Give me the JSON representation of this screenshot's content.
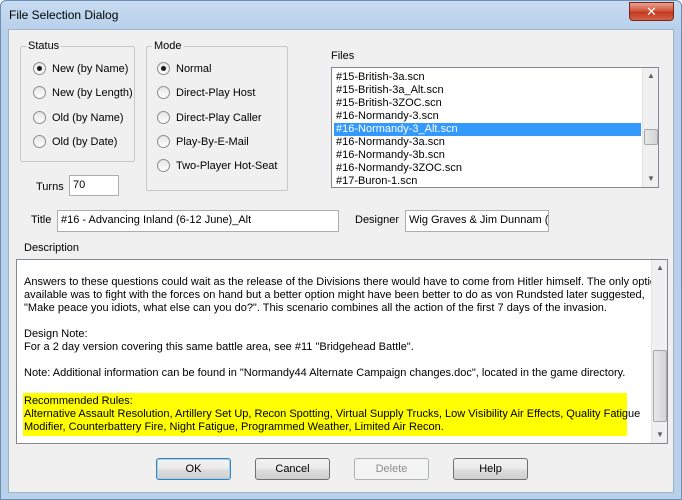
{
  "window": {
    "title": "File Selection Dialog",
    "close_glyph": "✕"
  },
  "status": {
    "label": "Status",
    "options": [
      {
        "label": "New (by Name)",
        "checked": true
      },
      {
        "label": "New (by Length)",
        "checked": false
      },
      {
        "label": "Old (by Name)",
        "checked": false
      },
      {
        "label": "Old (by Date)",
        "checked": false
      }
    ]
  },
  "mode": {
    "label": "Mode",
    "options": [
      {
        "label": "Normal",
        "checked": true
      },
      {
        "label": "Direct-Play Host",
        "checked": false
      },
      {
        "label": "Direct-Play Caller",
        "checked": false
      },
      {
        "label": "Play-By-E-Mail",
        "checked": false
      },
      {
        "label": "Two-Player Hot-Seat",
        "checked": false
      }
    ]
  },
  "turns": {
    "label": "Turns",
    "value": "70"
  },
  "files": {
    "label": "Files",
    "items": [
      "#15-British-3a.scn",
      "#15-British-3a_Alt.scn",
      "#15-British-3ZOC.scn",
      "#16-Normandy-3.scn",
      "#16-Normandy-3_Alt.scn",
      "#16-Normandy-3a.scn",
      "#16-Normandy-3b.scn",
      "#16-Normandy-3ZOC.scn",
      "#17-Buron-1.scn"
    ],
    "selected_index": 4
  },
  "scenario": {
    "title_label": "Title",
    "title_value": "#16 - Advancing Inland (6-12 June)_Alt",
    "designer_label": "Designer",
    "designer_value": "Wig Graves & Jim Dunnam (e"
  },
  "description": {
    "label": "Description",
    "lines": [
      "Answers to these questions could wait as the release of the Divisions there would have to come from Hitler himself. The only option",
      "available was to fight with the forces on hand but a better option might have been better to do as von Rundsted later suggested,",
      "\"Make peace you idiots, what else can you do?\". This scenario combines all the action of the first 7 days of the invasion.",
      "",
      "Design Note:",
      "For a 2 day version covering this same battle area, see #11 \"Bridgehead Battle\".",
      "",
      "Note: Additional information can be found in \"Normandy44 Alternate Campaign changes.doc\", located in the game directory."
    ],
    "rules_lines": [
      "Recommended Rules:",
      "Alternative Assault Resolution, Artillery Set Up, Recon Spotting, Virtual Supply Trucks, Low Visibility Air Effects, Quality Fatigue",
      "Modifier, Counterbattery Fire, Night Fatigue, Programmed Weather, Limited Air Recon."
    ],
    "rules_highlight_color": "#ffff00"
  },
  "buttons": {
    "ok": "OK",
    "cancel": "Cancel",
    "delete": "Delete",
    "help": "Help"
  },
  "icons": {
    "scroll_up": "▲",
    "scroll_down": "▼"
  },
  "colors": {
    "selection": "#3399ff",
    "dialog_bg": "#f0f0f0"
  }
}
